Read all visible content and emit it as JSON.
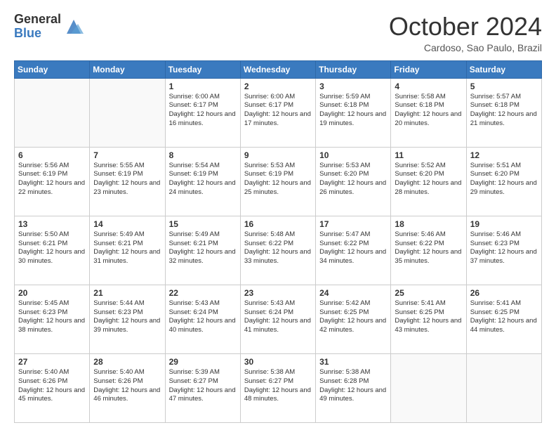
{
  "logo": {
    "general": "General",
    "blue": "Blue"
  },
  "header": {
    "title": "October 2024",
    "subtitle": "Cardoso, Sao Paulo, Brazil"
  },
  "weekdays": [
    "Sunday",
    "Monday",
    "Tuesday",
    "Wednesday",
    "Thursday",
    "Friday",
    "Saturday"
  ],
  "weeks": [
    [
      {
        "day": "",
        "info": ""
      },
      {
        "day": "",
        "info": ""
      },
      {
        "day": "1",
        "info": "Sunrise: 6:00 AM\nSunset: 6:17 PM\nDaylight: 12 hours and 16 minutes."
      },
      {
        "day": "2",
        "info": "Sunrise: 6:00 AM\nSunset: 6:17 PM\nDaylight: 12 hours and 17 minutes."
      },
      {
        "day": "3",
        "info": "Sunrise: 5:59 AM\nSunset: 6:18 PM\nDaylight: 12 hours and 19 minutes."
      },
      {
        "day": "4",
        "info": "Sunrise: 5:58 AM\nSunset: 6:18 PM\nDaylight: 12 hours and 20 minutes."
      },
      {
        "day": "5",
        "info": "Sunrise: 5:57 AM\nSunset: 6:18 PM\nDaylight: 12 hours and 21 minutes."
      }
    ],
    [
      {
        "day": "6",
        "info": "Sunrise: 5:56 AM\nSunset: 6:19 PM\nDaylight: 12 hours and 22 minutes."
      },
      {
        "day": "7",
        "info": "Sunrise: 5:55 AM\nSunset: 6:19 PM\nDaylight: 12 hours and 23 minutes."
      },
      {
        "day": "8",
        "info": "Sunrise: 5:54 AM\nSunset: 6:19 PM\nDaylight: 12 hours and 24 minutes."
      },
      {
        "day": "9",
        "info": "Sunrise: 5:53 AM\nSunset: 6:19 PM\nDaylight: 12 hours and 25 minutes."
      },
      {
        "day": "10",
        "info": "Sunrise: 5:53 AM\nSunset: 6:20 PM\nDaylight: 12 hours and 26 minutes."
      },
      {
        "day": "11",
        "info": "Sunrise: 5:52 AM\nSunset: 6:20 PM\nDaylight: 12 hours and 28 minutes."
      },
      {
        "day": "12",
        "info": "Sunrise: 5:51 AM\nSunset: 6:20 PM\nDaylight: 12 hours and 29 minutes."
      }
    ],
    [
      {
        "day": "13",
        "info": "Sunrise: 5:50 AM\nSunset: 6:21 PM\nDaylight: 12 hours and 30 minutes."
      },
      {
        "day": "14",
        "info": "Sunrise: 5:49 AM\nSunset: 6:21 PM\nDaylight: 12 hours and 31 minutes."
      },
      {
        "day": "15",
        "info": "Sunrise: 5:49 AM\nSunset: 6:21 PM\nDaylight: 12 hours and 32 minutes."
      },
      {
        "day": "16",
        "info": "Sunrise: 5:48 AM\nSunset: 6:22 PM\nDaylight: 12 hours and 33 minutes."
      },
      {
        "day": "17",
        "info": "Sunrise: 5:47 AM\nSunset: 6:22 PM\nDaylight: 12 hours and 34 minutes."
      },
      {
        "day": "18",
        "info": "Sunrise: 5:46 AM\nSunset: 6:22 PM\nDaylight: 12 hours and 35 minutes."
      },
      {
        "day": "19",
        "info": "Sunrise: 5:46 AM\nSunset: 6:23 PM\nDaylight: 12 hours and 37 minutes."
      }
    ],
    [
      {
        "day": "20",
        "info": "Sunrise: 5:45 AM\nSunset: 6:23 PM\nDaylight: 12 hours and 38 minutes."
      },
      {
        "day": "21",
        "info": "Sunrise: 5:44 AM\nSunset: 6:23 PM\nDaylight: 12 hours and 39 minutes."
      },
      {
        "day": "22",
        "info": "Sunrise: 5:43 AM\nSunset: 6:24 PM\nDaylight: 12 hours and 40 minutes."
      },
      {
        "day": "23",
        "info": "Sunrise: 5:43 AM\nSunset: 6:24 PM\nDaylight: 12 hours and 41 minutes."
      },
      {
        "day": "24",
        "info": "Sunrise: 5:42 AM\nSunset: 6:25 PM\nDaylight: 12 hours and 42 minutes."
      },
      {
        "day": "25",
        "info": "Sunrise: 5:41 AM\nSunset: 6:25 PM\nDaylight: 12 hours and 43 minutes."
      },
      {
        "day": "26",
        "info": "Sunrise: 5:41 AM\nSunset: 6:25 PM\nDaylight: 12 hours and 44 minutes."
      }
    ],
    [
      {
        "day": "27",
        "info": "Sunrise: 5:40 AM\nSunset: 6:26 PM\nDaylight: 12 hours and 45 minutes."
      },
      {
        "day": "28",
        "info": "Sunrise: 5:40 AM\nSunset: 6:26 PM\nDaylight: 12 hours and 46 minutes."
      },
      {
        "day": "29",
        "info": "Sunrise: 5:39 AM\nSunset: 6:27 PM\nDaylight: 12 hours and 47 minutes."
      },
      {
        "day": "30",
        "info": "Sunrise: 5:38 AM\nSunset: 6:27 PM\nDaylight: 12 hours and 48 minutes."
      },
      {
        "day": "31",
        "info": "Sunrise: 5:38 AM\nSunset: 6:28 PM\nDaylight: 12 hours and 49 minutes."
      },
      {
        "day": "",
        "info": ""
      },
      {
        "day": "",
        "info": ""
      }
    ]
  ]
}
